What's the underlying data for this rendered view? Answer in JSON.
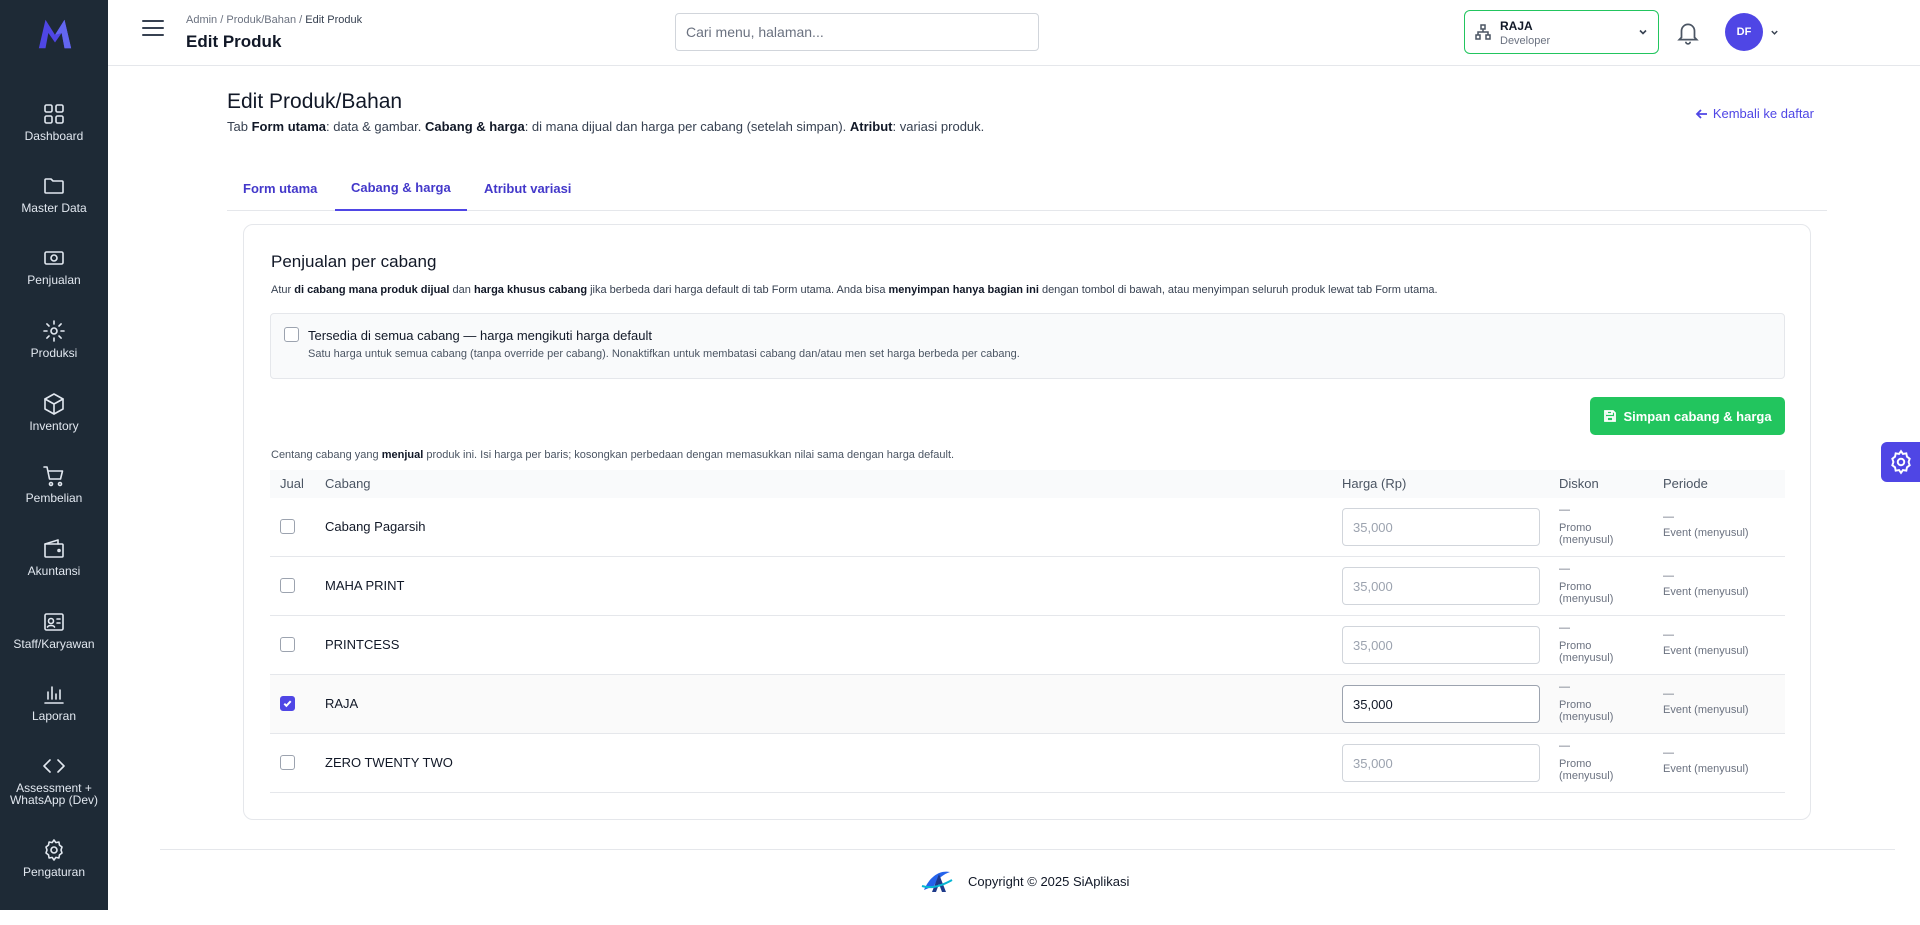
{
  "sidebar": {
    "items": [
      {
        "label": "Dashboard",
        "icon": "dashboard-icon"
      },
      {
        "label": "Master Data",
        "icon": "folder-icon"
      },
      {
        "label": "Penjualan",
        "icon": "cash-icon"
      },
      {
        "label": "Produksi",
        "icon": "gear-icon"
      },
      {
        "label": "Inventory",
        "icon": "box-icon"
      },
      {
        "label": "Pembelian",
        "icon": "cart-icon"
      },
      {
        "label": "Akuntansi",
        "icon": "wallet-icon"
      },
      {
        "label": "Staff/Karyawan",
        "icon": "id-card-icon"
      },
      {
        "label": "Laporan",
        "icon": "bar-chart-icon"
      },
      {
        "label": "Assessment + WhatsApp (Dev)",
        "icon": "code-icon"
      },
      {
        "label": "Pengaturan",
        "icon": "settings-icon"
      }
    ]
  },
  "header": {
    "breadcrumb": {
      "part1": "Admin",
      "sep": " / ",
      "part2": "Produk/Bahan",
      "current": "Edit Produk"
    },
    "title": "Edit Produk",
    "search_placeholder": "Cari menu, halaman...",
    "branch": {
      "name": "RAJA",
      "role": "Developer"
    },
    "avatar_initials": "DF"
  },
  "page": {
    "title": "Edit Produk/Bahan",
    "desc": {
      "p1": "Tab ",
      "b1": "Form utama",
      "p2": ": data & gambar. ",
      "b2": "Cabang & harga",
      "p3": ": di mana dijual dan harga per cabang (setelah simpan). ",
      "b3": "Atribut",
      "p4": ": variasi produk."
    },
    "back_label": "Kembali ke daftar"
  },
  "tabs": [
    {
      "label": "Form utama",
      "active": false
    },
    {
      "label": "Cabang & harga",
      "active": true
    },
    {
      "label": "Atribut variasi",
      "active": false
    }
  ],
  "card": {
    "title": "Penjualan per cabang",
    "desc": {
      "p1": "Atur ",
      "b1": "di cabang mana produk dijual",
      "p2": " dan ",
      "b2": "harga khusus cabang",
      "p3": " jika berbeda dari harga default di tab Form utama. Anda bisa ",
      "b3": "menyimpan hanya bagian ini",
      "p4": " dengan tombol di bawah, atau menyimpan seluruh produk lewat tab Form utama."
    },
    "all_branches": {
      "label": "Tersedia di semua cabang — harga mengikuti harga default",
      "hint": "Satu harga untuk semua cabang (tanpa override per cabang). Nonaktifkan untuk membatasi cabang dan/atau men set harga berbeda per cabang.",
      "checked": false
    },
    "save_label": "Simpan cabang & harga",
    "table_note": {
      "p1": "Centang cabang yang ",
      "b1": "menjual",
      "p2": " produk ini. Isi harga per baris; kosongkan perbedaan dengan memasukkan nilai sama dengan harga default."
    },
    "columns": {
      "jual": "Jual",
      "cabang": "Cabang",
      "harga": "Harga (Rp)",
      "diskon": "Diskon",
      "periode": "Periode"
    },
    "rows": [
      {
        "name": "Cabang Pagarsih",
        "price": "35,000",
        "checked": false,
        "diskon_dash": "—",
        "diskon": "Promo (menyusul)",
        "periode_dash": "—",
        "periode": "Event (menyusul)"
      },
      {
        "name": "MAHA PRINT",
        "price": "35,000",
        "checked": false,
        "diskon_dash": "—",
        "diskon": "Promo (menyusul)",
        "periode_dash": "—",
        "periode": "Event (menyusul)"
      },
      {
        "name": "PRINTCESS",
        "price": "35,000",
        "checked": false,
        "diskon_dash": "—",
        "diskon": "Promo (menyusul)",
        "periode_dash": "—",
        "periode": "Event (menyusul)"
      },
      {
        "name": "RAJA",
        "price": "35,000",
        "checked": true,
        "diskon_dash": "—",
        "diskon": "Promo (menyusul)",
        "periode_dash": "—",
        "periode": "Event (menyusul)"
      },
      {
        "name": "ZERO TWENTY TWO",
        "price": "35,000",
        "checked": false,
        "diskon_dash": "—",
        "diskon": "Promo (menyusul)",
        "periode_dash": "—",
        "periode": "Event (menyusul)"
      }
    ]
  },
  "footer": {
    "copyright": "Copyright © 2025 SiAplikasi"
  },
  "colors": {
    "sidebar": "#1e2a36",
    "accent": "#4f46e5",
    "success": "#22c55e"
  }
}
